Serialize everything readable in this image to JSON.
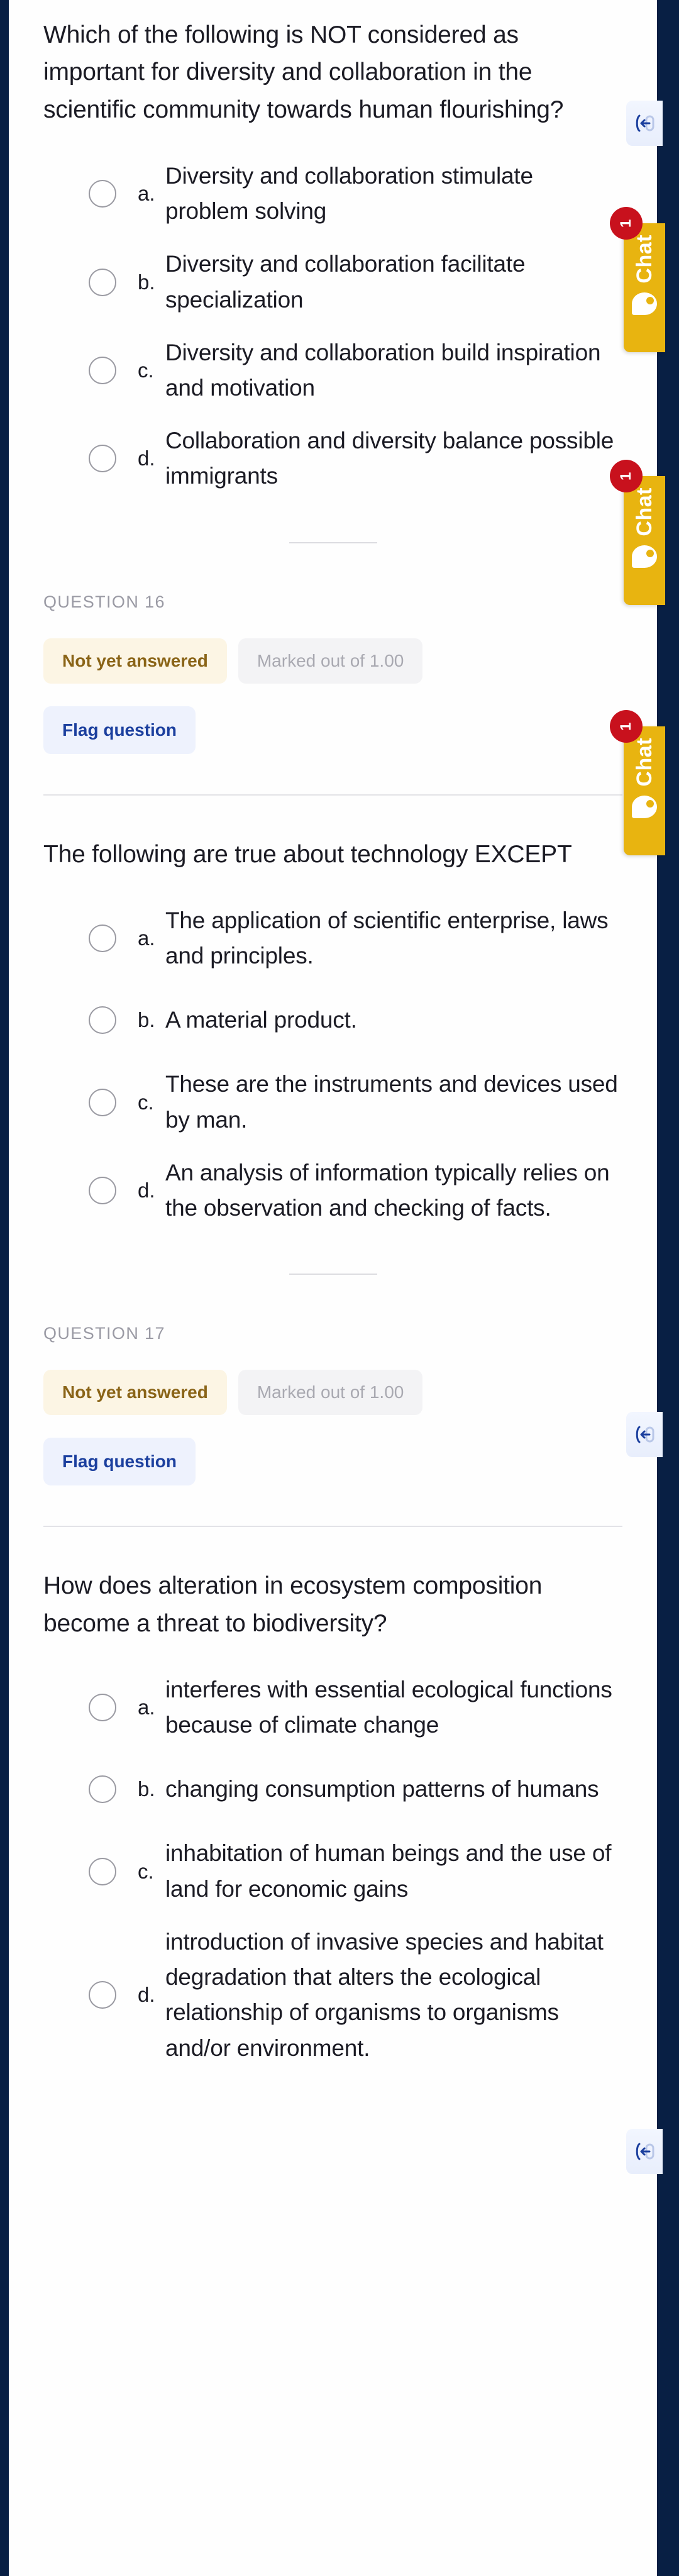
{
  "theme": {
    "frame_navy": "#081f44",
    "chat_yellow": "#e8b410",
    "chat_badge_red": "#c8111d",
    "flag_blue": "#1b3f9e",
    "badge_warn_bg": "#fcf5e4",
    "badge_warn_text": "#8a6417"
  },
  "chat_widget": {
    "label": "Chat",
    "unread_count": "1",
    "bubble_icon": "chat-bubble-icon"
  },
  "a11y_toggle": {
    "icon": "collapse-panel-icon"
  },
  "questions": [
    {
      "id": "q15",
      "text": "Which of the following is NOT considered as important for diversity and collaboration in the scientific community towards human flourishing?",
      "options": [
        {
          "letter": "a.",
          "text": "Diversity and collaboration stimulate problem solving"
        },
        {
          "letter": "b.",
          "text": "Diversity and collaboration facilitate specialization"
        },
        {
          "letter": "c.",
          "text": "Diversity and collaboration build inspiration and motivation"
        },
        {
          "letter": "d.",
          "text": "Collaboration and diversity balance possible immigrants"
        }
      ]
    },
    {
      "id": "q16",
      "number_label": "QUESTION 16",
      "status_label": "Not yet answered",
      "marks_label": "Marked out of 1.00",
      "flag_label": "Flag question",
      "text": "The following are true about technology EXCEPT",
      "options": [
        {
          "letter": "a.",
          "text": "The application of scientific enterprise, laws and principles."
        },
        {
          "letter": "b.",
          "text": "A material product."
        },
        {
          "letter": "c.",
          "text": "These are the instruments and devices used by man."
        },
        {
          "letter": "d.",
          "text": "An analysis of information typically relies on the observation and checking of facts."
        }
      ]
    },
    {
      "id": "q17",
      "number_label": "QUESTION 17",
      "status_label": "Not yet answered",
      "marks_label": "Marked out of 1.00",
      "flag_label": "Flag question",
      "text": "How does alteration in ecosystem composition become a threat to biodiversity?",
      "options": [
        {
          "letter": "a.",
          "text": "interferes with essential ecological functions because of climate change"
        },
        {
          "letter": "b.",
          "text": "changing consumption patterns of humans"
        },
        {
          "letter": "c.",
          "text": "inhabitation of human beings and the use of land for economic gains"
        },
        {
          "letter": "d.",
          "text": "introduction of invasive species and habitat degradation that alters the ecological relationship of organisms to organisms and/or environment."
        }
      ]
    }
  ]
}
